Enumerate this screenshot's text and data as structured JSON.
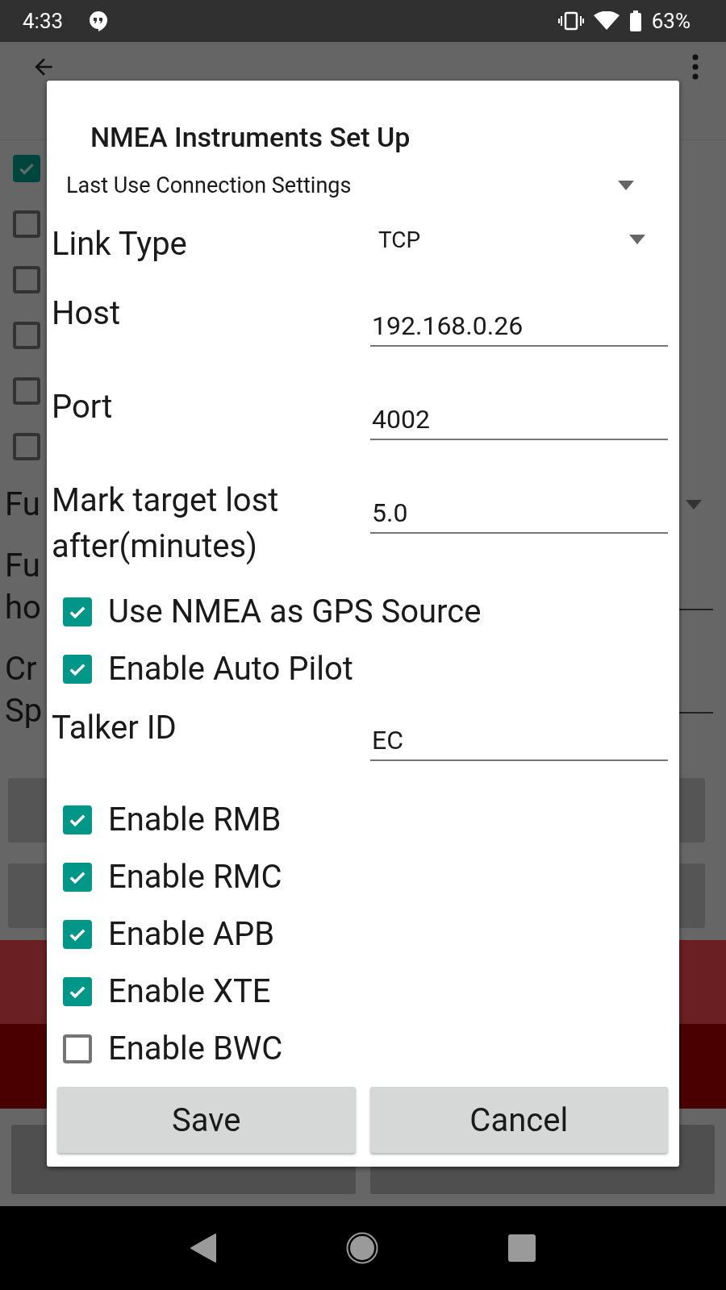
{
  "status_bar": {
    "time": "4:33",
    "battery": "63%"
  },
  "background": {
    "checkboxes": [
      {
        "checked": true
      },
      {
        "checked": false
      },
      {
        "checked": false
      },
      {
        "checked": false
      },
      {
        "checked": false
      },
      {
        "checked": false
      }
    ],
    "settings": [
      {
        "kind": "dropdown",
        "lines": [
          "Fu"
        ]
      },
      {
        "kind": "input",
        "lines": [
          "Fu",
          "ho"
        ]
      },
      {
        "kind": "input",
        "lines": [
          "Cr",
          "Sp"
        ]
      }
    ]
  },
  "dialog": {
    "title": "NMEA Instruments Set Up",
    "preset": "Last Use Connection Settings",
    "items": [
      {
        "kind": "dropdown",
        "label": "Link Type",
        "value": "TCP"
      },
      {
        "kind": "input",
        "label": "Host",
        "value": "192.168.0.26"
      },
      {
        "kind": "input",
        "label": "Port",
        "value": "4002"
      },
      {
        "kind": "input",
        "label": "Mark target lost after(minutes)",
        "value": "5.0"
      },
      {
        "kind": "checkbox",
        "text": "Use NMEA as GPS Source",
        "checked": true
      },
      {
        "kind": "checkbox",
        "text": "Enable Auto Pilot",
        "checked": true
      },
      {
        "kind": "input",
        "label": "Talker ID",
        "value": "EC"
      },
      {
        "kind": "checkbox",
        "text": "Enable RMB",
        "checked": true
      },
      {
        "kind": "checkbox",
        "text": "Enable RMC",
        "checked": true
      },
      {
        "kind": "checkbox",
        "text": "Enable APB",
        "checked": true
      },
      {
        "kind": "checkbox",
        "text": "Enable XTE",
        "checked": true
      },
      {
        "kind": "checkbox",
        "text": "Enable BWC",
        "checked": false
      }
    ],
    "buttons": [
      "Save",
      "Cancel"
    ]
  }
}
